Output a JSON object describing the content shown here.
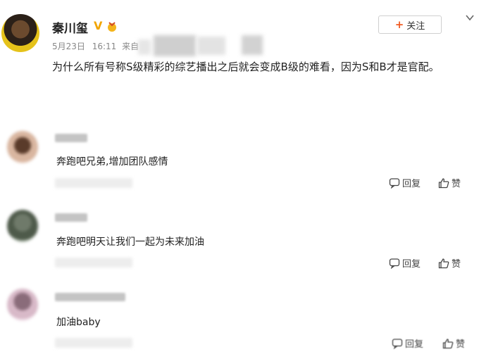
{
  "post": {
    "username": "秦川玺",
    "verified_badge": "V",
    "date": "5月23日",
    "time": "16:11",
    "source_prefix": "来自",
    "follow_label": "关注",
    "text": "为什么所有号称S级精彩的综艺播出之后就会变成B级的难看，因为S和B才是官配。"
  },
  "comments": [
    {
      "text": "奔跑吧兄弟,增加团队感情",
      "reply_label": "回复",
      "like_label": "赞"
    },
    {
      "text": "奔跑吧明天让我们一起为未来加油",
      "reply_label": "回复",
      "like_label": "赞"
    },
    {
      "text": "加油baby",
      "reply_label": "回复",
      "like_label": "赞"
    }
  ],
  "colors": {
    "verified": "#f2a500",
    "follow_plus": "#f15a22",
    "text": "#222222",
    "muted": "#888888"
  },
  "icons": [
    "medal-icon",
    "chevron-down-icon",
    "reply-icon",
    "like-icon"
  ]
}
